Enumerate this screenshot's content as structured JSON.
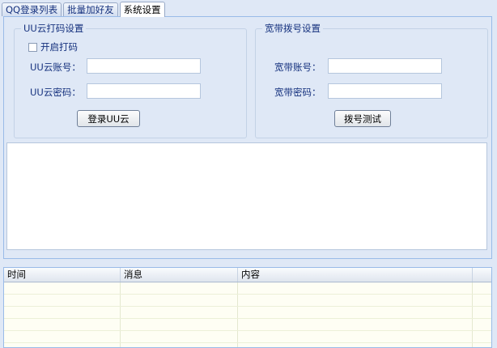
{
  "tabs": [
    {
      "label": "QQ登录列表",
      "active": false
    },
    {
      "label": "批量加好友",
      "active": false
    },
    {
      "label": "系统设置",
      "active": true
    }
  ],
  "uu_group": {
    "legend": "UU云打码设置",
    "enable_checkbox_label": "开启打码",
    "enable_checked": false,
    "account_label": "UU云账号：",
    "account_value": "",
    "password_label": "UU云密码：",
    "password_value": "",
    "login_button": "登录UU云"
  },
  "broadband_group": {
    "legend": "宽带拨号设置",
    "account_label": "宽带账号：",
    "account_value": "",
    "password_label": "宽带密码：",
    "password_value": "",
    "dial_button": "拨号测试"
  },
  "log_text": "",
  "grid": {
    "columns": [
      "时间",
      "消息",
      "内容"
    ],
    "rows": [
      [
        "",
        "",
        ""
      ],
      [
        "",
        "",
        ""
      ],
      [
        "",
        "",
        ""
      ],
      [
        "",
        "",
        ""
      ],
      [
        "",
        "",
        ""
      ],
      [
        "",
        "",
        ""
      ]
    ]
  }
}
